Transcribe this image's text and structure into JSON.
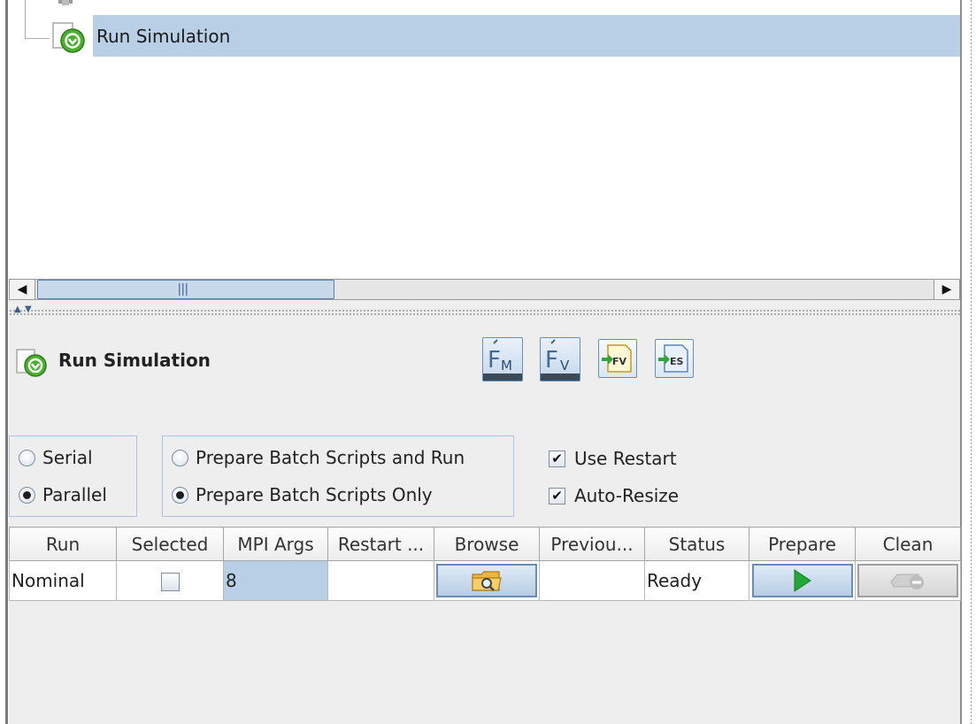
{
  "tree": {
    "selected_node": "Run Simulation"
  },
  "panel": {
    "title": "Run Simulation",
    "toolbar": [
      {
        "name": "fm-button",
        "icon": "fm-icon",
        "label": "FM"
      },
      {
        "name": "fv-button",
        "icon": "fv-icon",
        "label": "FV"
      },
      {
        "name": "export-fv-button",
        "icon": "export-fv-icon",
        "label": "FV"
      },
      {
        "name": "export-es-button",
        "icon": "export-es-icon",
        "label": "ES"
      }
    ]
  },
  "options": {
    "mode": {
      "serial_label": "Serial",
      "parallel_label": "Parallel",
      "selected": "Parallel"
    },
    "prepare": {
      "run_label": "Prepare Batch Scripts and Run",
      "only_label": "Prepare Batch Scripts Only",
      "selected": "Prepare Batch Scripts Only"
    },
    "use_restart_label": "Use Restart",
    "use_restart_checked": true,
    "auto_resize_label": "Auto-Resize",
    "auto_resize_checked": true,
    "check_mark": "✔"
  },
  "table": {
    "headers": [
      "Run",
      "Selected",
      "MPI Args",
      "Restart ...",
      "Browse",
      "Previou...",
      "Status",
      "Prepare",
      "Clean"
    ],
    "rows": [
      {
        "run": "Nominal",
        "selected": false,
        "mpi_args": "8",
        "restart": "",
        "previous": "",
        "status": "Ready"
      }
    ]
  },
  "colors": {
    "selection": "#b8cfe5",
    "accent_border": "#6b8db5",
    "play_green": "#22a838",
    "node_green": "#4caf2f",
    "folder": "#f0b53d"
  }
}
